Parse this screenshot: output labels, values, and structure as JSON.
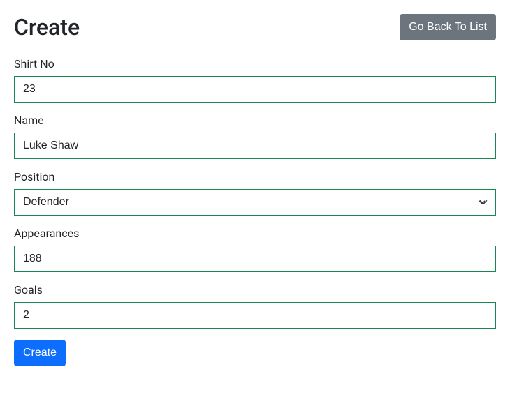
{
  "header": {
    "title": "Create",
    "back_button_label": "Go Back To List"
  },
  "form": {
    "fields": {
      "shirt_no": {
        "label": "Shirt No",
        "value": "23"
      },
      "name": {
        "label": "Name",
        "value": "Luke Shaw"
      },
      "position": {
        "label": "Position",
        "value": "Defender",
        "options": [
          "Defender"
        ]
      },
      "appearances": {
        "label": "Appearances",
        "value": "188"
      },
      "goals": {
        "label": "Goals",
        "value": "2"
      }
    },
    "submit_label": "Create"
  },
  "colors": {
    "valid_border": "#198754",
    "primary": "#0d6efd",
    "secondary": "#6c757d"
  }
}
